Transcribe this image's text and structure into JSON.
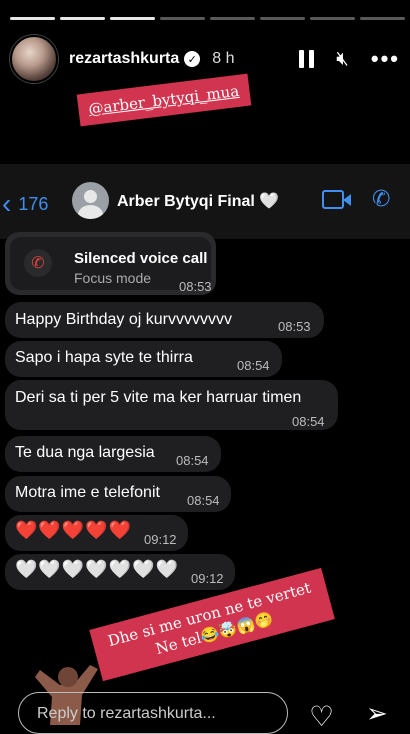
{
  "story": {
    "username": "rezartashkurta",
    "time": "8 h",
    "mention": "@arber_bytyqi_mua",
    "caption_line1": "Dhe si me uron ne te vertet",
    "caption_line2": "Ne tel😂🤯😱🤭",
    "reply_placeholder": "Reply to rezartashkurta...",
    "icons": {
      "pause": "pause-icon",
      "mute": "mute-icon",
      "more": "more-icon",
      "verified": "verified-icon",
      "like": "heart-icon",
      "send": "send-icon"
    }
  },
  "chat": {
    "back_count": "176",
    "contact_name": "Arber Bytyqi Final 🤍",
    "call": {
      "title": "Silenced voice call",
      "subtitle": "Focus mode",
      "time": "08:53"
    },
    "messages": [
      {
        "text": "Happy Birthday oj kurvvvvvvvv",
        "time": "08:53"
      },
      {
        "text": "Sapo i hapa syte te thirra",
        "time": "08:54"
      },
      {
        "text": "Deri sa ti per 5 vite ma ker harruar timen",
        "time": "08:54"
      },
      {
        "text": "Te dua nga largesia",
        "time": "08:54"
      },
      {
        "text": "Motra ime e telefonit",
        "time": "08:54"
      },
      {
        "text": "❤️❤️❤️❤️❤️",
        "time": "09:12"
      },
      {
        "text": "🤍🤍🤍🤍🤍🤍🤍",
        "time": "09:12"
      }
    ]
  },
  "colors": {
    "accent_blue": "#3e8ff0",
    "sticker_red": "#d1344f",
    "bubble": "#1f1f22"
  }
}
